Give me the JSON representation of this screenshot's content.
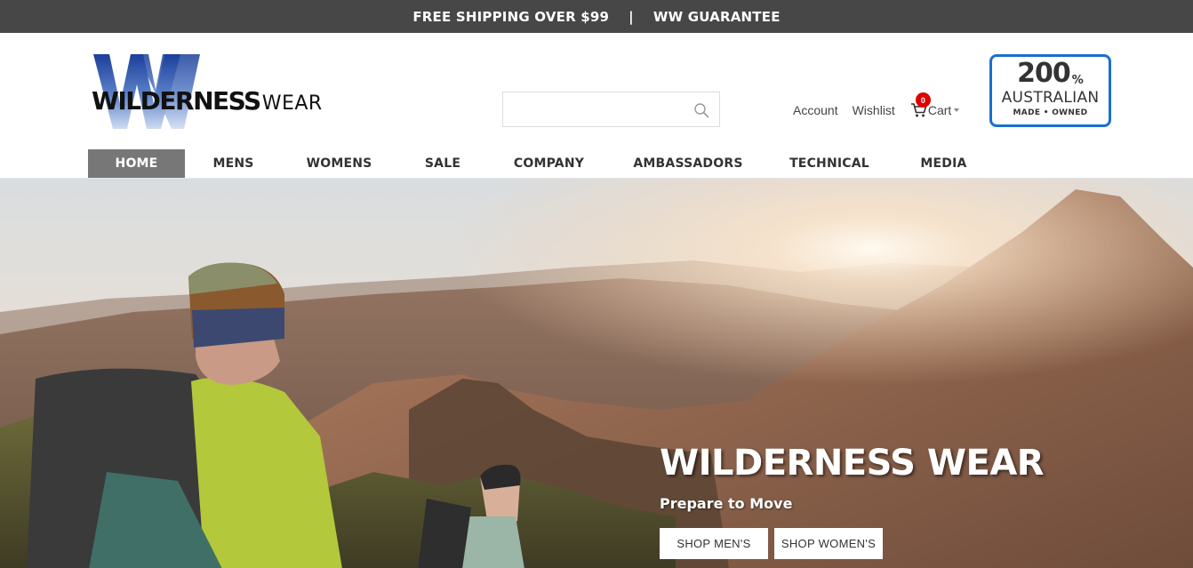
{
  "promo": {
    "shipping": "FREE SHIPPING OVER $99",
    "separator": "|",
    "guarantee": "WW GUARANTEE"
  },
  "brand": {
    "name_bold": "WILDERNESS",
    "name_light": "WEAR",
    "monogram": "WW",
    "colors": {
      "blue": "#1b3f9c",
      "dark": "#111111"
    }
  },
  "search": {
    "placeholder": "",
    "icon": "search-icon"
  },
  "header_links": {
    "account": "Account",
    "wishlist": "Wishlist",
    "cart_label": "Cart",
    "cart_count": "0"
  },
  "badge": {
    "number": "200",
    "percent": "%",
    "country": "AUSTRALIAN",
    "made": "MADE • OWNED",
    "border_color": "#1a6fd1"
  },
  "nav": {
    "items": [
      {
        "label": "HOME",
        "active": true
      },
      {
        "label": "MENS"
      },
      {
        "label": "WOMENS"
      },
      {
        "label": "SALE"
      },
      {
        "label": "COMPANY"
      },
      {
        "label": "AMBASSADORS"
      },
      {
        "label": "TECHNICAL"
      },
      {
        "label": "MEDIA"
      }
    ]
  },
  "hero": {
    "title": "WILDERNESS WEAR",
    "subtitle": "Prepare to Move",
    "buttons": {
      "mens": "SHOP MEN'S",
      "womens": "SHOP WOMEN'S"
    }
  },
  "colors": {
    "promo_bar": "#474747",
    "nav_active": "#777777",
    "cart_badge": "#e00000"
  }
}
